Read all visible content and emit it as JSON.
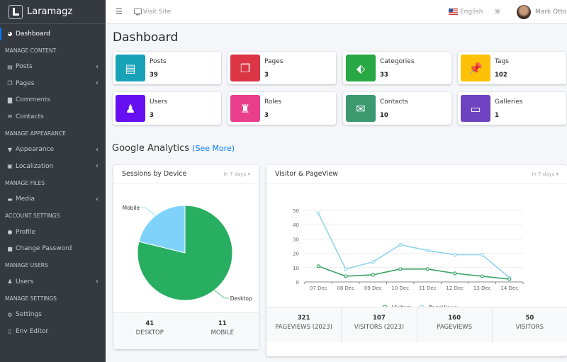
{
  "brand": {
    "name": "Laramagz"
  },
  "sidebar": {
    "items": [
      {
        "type": "item",
        "label": "Dashboard",
        "icon": "tachometer-icon",
        "glyph": "◕",
        "active": true
      },
      {
        "type": "header",
        "label": "MANAGE CONTENT"
      },
      {
        "type": "item",
        "label": "Posts",
        "icon": "book-icon",
        "glyph": "▤",
        "chevron": true
      },
      {
        "type": "item",
        "label": "Pages",
        "icon": "copy-icon",
        "glyph": "❐",
        "chevron": true
      },
      {
        "type": "item",
        "label": "Comments",
        "icon": "comment-icon",
        "glyph": "▇"
      },
      {
        "type": "item",
        "label": "Contacts",
        "icon": "envelope-icon",
        "glyph": "✉"
      },
      {
        "type": "header",
        "label": "MANAGE APPEARANCE"
      },
      {
        "type": "item",
        "label": "Appearance",
        "icon": "paint-roller-icon",
        "glyph": "▼",
        "chevron": true
      },
      {
        "type": "item",
        "label": "Localization",
        "icon": "language-icon",
        "glyph": "▣",
        "chevron": true
      },
      {
        "type": "header",
        "label": "MANAGE FILES"
      },
      {
        "type": "item",
        "label": "Media",
        "icon": "photo-video-icon",
        "glyph": "▬",
        "chevron": true
      },
      {
        "type": "header",
        "label": "ACCOUNT SETTINGS"
      },
      {
        "type": "item",
        "label": "Profile",
        "icon": "user-icon",
        "glyph": "●"
      },
      {
        "type": "item",
        "label": "Change Password",
        "icon": "lock-icon",
        "glyph": "■"
      },
      {
        "type": "header",
        "label": "MANAGE USERS"
      },
      {
        "type": "item",
        "label": "Users",
        "icon": "users-icon",
        "glyph": "♟",
        "chevron": true
      },
      {
        "type": "header",
        "label": "MANAGE SETTINGS"
      },
      {
        "type": "item",
        "label": "Settings",
        "icon": "cogs-icon",
        "glyph": "⚙"
      },
      {
        "type": "item",
        "label": "Env Editor",
        "icon": "file-icon",
        "glyph": "▯"
      }
    ]
  },
  "topbar": {
    "visit_site": "Visit Site",
    "language": "English",
    "user_name": "Mark Otto"
  },
  "page": {
    "title": "Dashboard"
  },
  "info_boxes": [
    {
      "label": "Posts",
      "value": "39",
      "color": "#17a2b8",
      "icon": "book-icon",
      "glyph": "▤"
    },
    {
      "label": "Pages",
      "value": "3",
      "color": "#dc3545",
      "icon": "copy-icon",
      "glyph": "❐"
    },
    {
      "label": "Categories",
      "value": "33",
      "color": "#28a745",
      "icon": "tags-icon",
      "glyph": "⬖"
    },
    {
      "label": "Tags",
      "value": "102",
      "color": "#ffc107",
      "icon": "thumbtack-icon",
      "glyph": "📌"
    },
    {
      "label": "Users",
      "value": "3",
      "color": "#6610f2",
      "icon": "users-icon",
      "glyph": "♟"
    },
    {
      "label": "Roles",
      "value": "3",
      "color": "#e83e8c",
      "icon": "user-shield-icon",
      "glyph": "♜"
    },
    {
      "label": "Contacts",
      "value": "10",
      "color": "#3d9970",
      "icon": "envelope-icon",
      "glyph": "✉"
    },
    {
      "label": "Galleries",
      "value": "1",
      "color": "#6f42c1",
      "icon": "hdd-icon",
      "glyph": "▭"
    }
  ],
  "analytics": {
    "title": "Google Analytics",
    "see_more": "(See More)"
  },
  "sessions": {
    "title": "Sessions by Device",
    "range": "In 7 days",
    "stats": [
      {
        "value": "41",
        "label": "DESKTOP"
      },
      {
        "value": "11",
        "label": "MOBILE"
      }
    ]
  },
  "visitors": {
    "title": "Visitor & PageView",
    "range": "In 7 days",
    "stats": [
      {
        "value": "321",
        "label": "PAGEVIEWS (2023)"
      },
      {
        "value": "107",
        "label": "VISITORS (2023)"
      },
      {
        "value": "160",
        "label": "PAGEVIEWS"
      },
      {
        "value": "50",
        "label": "VISITORS"
      }
    ]
  },
  "chart_data": [
    {
      "type": "pie",
      "title": "Sessions by Device",
      "labels": [
        "Desktop",
        "Mobile"
      ],
      "values": [
        41,
        11
      ],
      "colors": [
        "#28ae60",
        "#7fd3fa"
      ]
    },
    {
      "type": "line",
      "title": "Visitor & PageView",
      "categories": [
        "07 Dec",
        "08 Dec",
        "09 Dec",
        "10 Dec",
        "11 Dec",
        "12 Dec",
        "13 Dec",
        "14 Dec"
      ],
      "series": [
        {
          "name": "Visitors",
          "values": [
            11,
            4,
            5,
            9,
            9,
            6,
            4,
            2
          ],
          "color": "#3aa463"
        },
        {
          "name": "PageViews",
          "values": [
            48,
            9,
            14,
            26,
            22,
            19,
            19,
            3
          ],
          "color": "#8fd4ef"
        }
      ],
      "ylim": [
        0,
        50
      ],
      "yticks": [
        0,
        10,
        20,
        30,
        40,
        50
      ],
      "grid": true,
      "legend": "bottom"
    }
  ]
}
